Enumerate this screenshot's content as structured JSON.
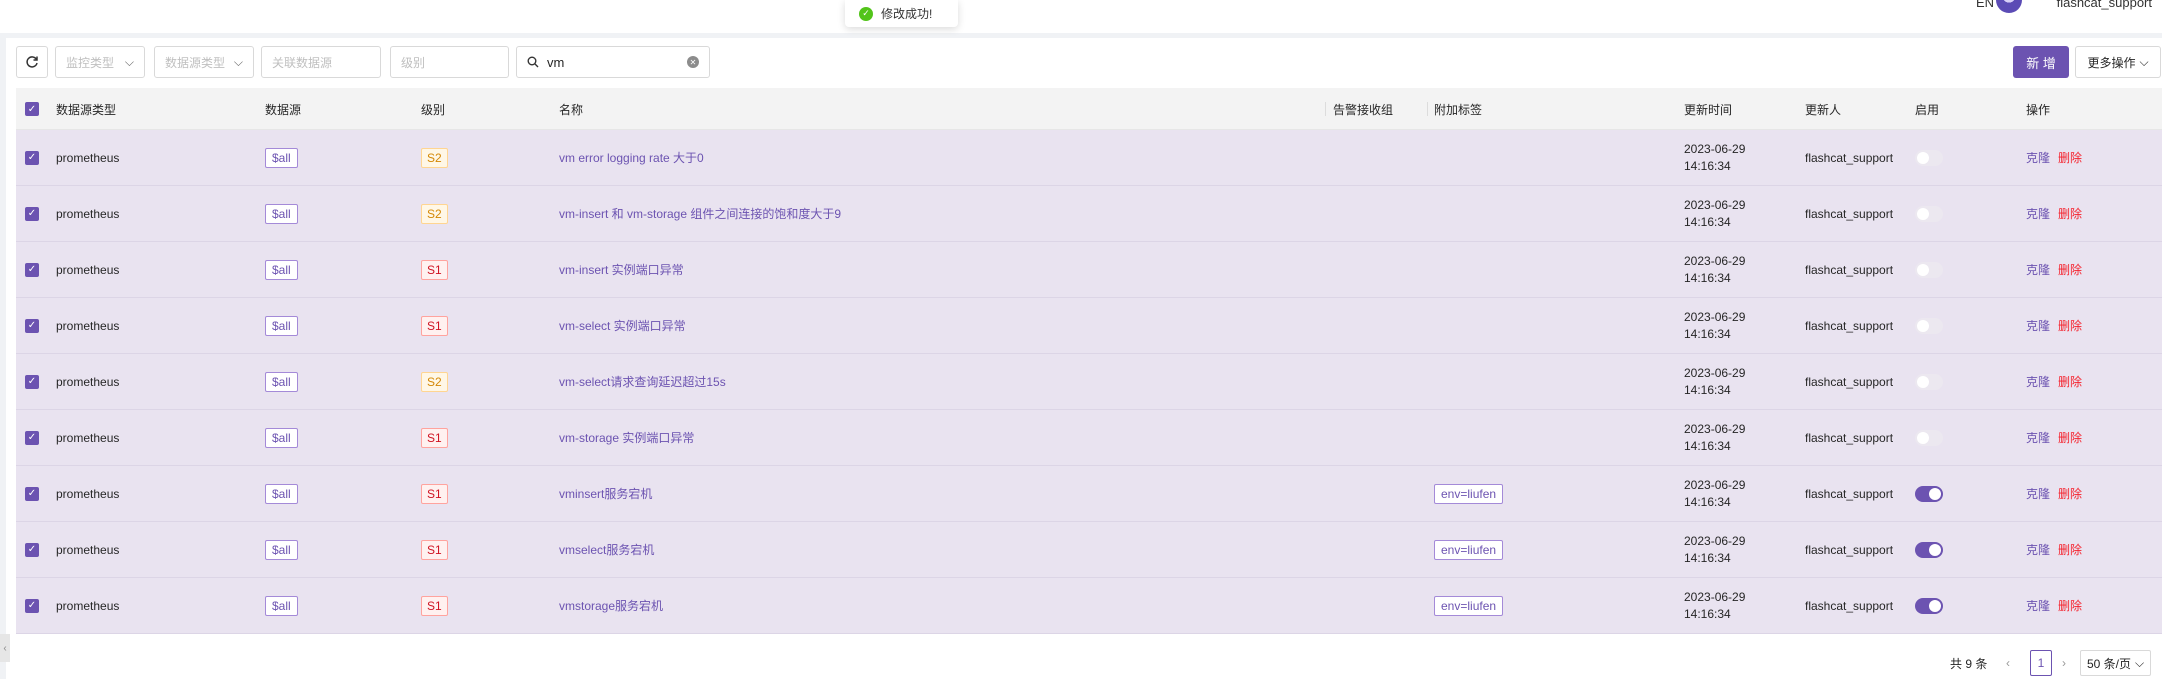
{
  "topbar": {
    "lang": "EN",
    "username": "flashcat_support"
  },
  "toast": {
    "message": "修改成功!"
  },
  "filters": {
    "monitor_type": "监控类型",
    "datasource_type": "数据源类型",
    "related_datasource": "关联数据源",
    "level": "级别",
    "search_value": "vm"
  },
  "actions": {
    "add": "新 增",
    "more": "更多操作"
  },
  "table": {
    "headers": {
      "ds_type": "数据源类型",
      "ds": "数据源",
      "level": "级别",
      "name": "名称",
      "notify_group": "告警接收组",
      "extra_tags": "附加标签",
      "updated_at": "更新时间",
      "updated_by": "更新人",
      "enabled": "启用",
      "ops": "操作"
    },
    "rows": [
      {
        "ds_type": "prometheus",
        "ds": "$all",
        "level": "S2",
        "name": "vm error logging rate 大于0",
        "tag": "",
        "date": "2023-06-29",
        "time": "14:16:34",
        "user": "flashcat_support",
        "enabled": false,
        "clone": "克隆",
        "delete": "删除"
      },
      {
        "ds_type": "prometheus",
        "ds": "$all",
        "level": "S2",
        "name": "vm-insert 和 vm-storage 组件之间连接的饱和度大于9",
        "tag": "",
        "date": "2023-06-29",
        "time": "14:16:34",
        "user": "flashcat_support",
        "enabled": false,
        "clone": "克隆",
        "delete": "删除"
      },
      {
        "ds_type": "prometheus",
        "ds": "$all",
        "level": "S1",
        "name": "vm-insert 实例端口异常",
        "tag": "",
        "date": "2023-06-29",
        "time": "14:16:34",
        "user": "flashcat_support",
        "enabled": false,
        "clone": "克隆",
        "delete": "删除"
      },
      {
        "ds_type": "prometheus",
        "ds": "$all",
        "level": "S1",
        "name": "vm-select 实例端口异常",
        "tag": "",
        "date": "2023-06-29",
        "time": "14:16:34",
        "user": "flashcat_support",
        "enabled": false,
        "clone": "克隆",
        "delete": "删除"
      },
      {
        "ds_type": "prometheus",
        "ds": "$all",
        "level": "S2",
        "name": "vm-select请求查询延迟超过15s",
        "tag": "",
        "date": "2023-06-29",
        "time": "14:16:34",
        "user": "flashcat_support",
        "enabled": false,
        "clone": "克隆",
        "delete": "删除"
      },
      {
        "ds_type": "prometheus",
        "ds": "$all",
        "level": "S1",
        "name": "vm-storage 实例端口异常",
        "tag": "",
        "date": "2023-06-29",
        "time": "14:16:34",
        "user": "flashcat_support",
        "enabled": false,
        "clone": "克隆",
        "delete": "删除"
      },
      {
        "ds_type": "prometheus",
        "ds": "$all",
        "level": "S1",
        "name": "vminsert服务宕机",
        "tag": "env=liufen",
        "date": "2023-06-29",
        "time": "14:16:34",
        "user": "flashcat_support",
        "enabled": true,
        "clone": "克隆",
        "delete": "删除"
      },
      {
        "ds_type": "prometheus",
        "ds": "$all",
        "level": "S1",
        "name": "vmselect服务宕机",
        "tag": "env=liufen",
        "date": "2023-06-29",
        "time": "14:16:34",
        "user": "flashcat_support",
        "enabled": true,
        "clone": "克隆",
        "delete": "删除"
      },
      {
        "ds_type": "prometheus",
        "ds": "$all",
        "level": "S1",
        "name": "vmstorage服务宕机",
        "tag": "env=liufen",
        "date": "2023-06-29",
        "time": "14:16:34",
        "user": "flashcat_support",
        "enabled": true,
        "clone": "克隆",
        "delete": "删除"
      }
    ]
  },
  "pagination": {
    "total": "共 9 条",
    "current": "1",
    "page_size": "50 条/页"
  },
  "colors": {
    "accent": "#6c53b1",
    "danger": "#f5222d",
    "row_selected": "#e9e3f0"
  },
  "icons": {
    "refresh": "refresh-icon",
    "search": "search-icon",
    "clear": "clear-icon",
    "chevron": "chevron-down-icon",
    "success": "check-circle-icon"
  }
}
